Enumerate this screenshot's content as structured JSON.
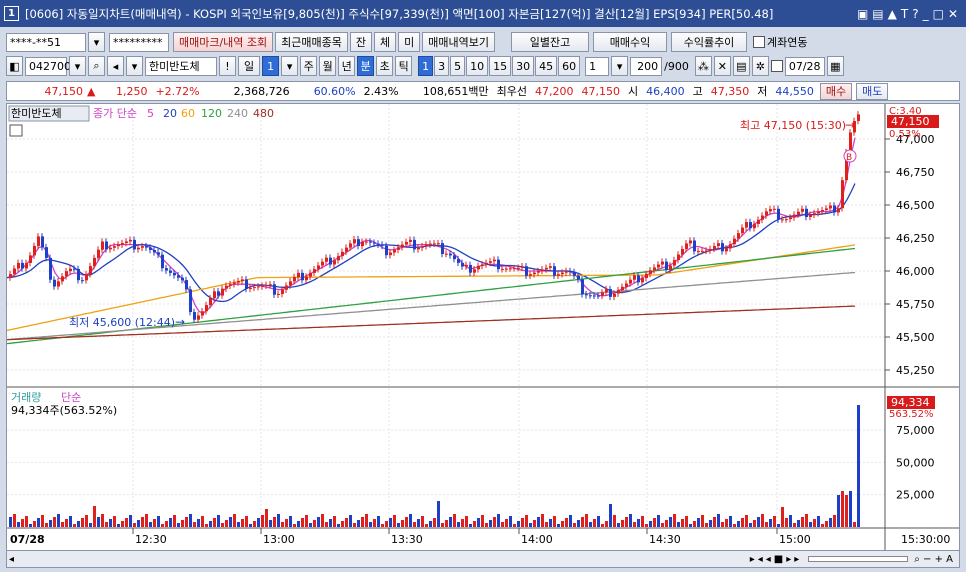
{
  "window": {
    "icon_text": "1",
    "title": "[0606] 자동일지차트(매매내역) - KOSPI 외국인보유[9,805(천)] 주식수[97,339(천)] 액면[100] 자본금[127(억)] 결산[12월] EPS[934] PER[50.48]"
  },
  "toolbar1": {
    "account": "****-**51",
    "password": "*********",
    "btn_mark": "매매마크/내역 조회",
    "btn_recent": "최근매매종목",
    "btn_jan": "잔",
    "btn_che": "체",
    "btn_mi": "미",
    "btn_view": "매매내역보기",
    "btn_daily": "일별잔고",
    "btn_profit": "매매수익",
    "btn_rate": "수익률추이",
    "chk_account": "계좌연동"
  },
  "toolbar2": {
    "code": "042700",
    "name": "한미반도체",
    "period_day": "일",
    "period_num": "1",
    "btn_week": "주",
    "btn_month": "월",
    "btn_year": "년",
    "btn_min": "분",
    "btn_sec": "초",
    "btn_tick": "틱",
    "intervals": [
      "1",
      "3",
      "5",
      "10",
      "15",
      "30",
      "45",
      "60"
    ],
    "interval_sel": "1",
    "count": "200",
    "total": "/900",
    "date": "07/28"
  },
  "info": {
    "price": "47,150",
    "change": "1,250",
    "rate": "+2.72%",
    "volume": "2,368,726",
    "vol_ratio": "60.60%",
    "v2": "2.43%",
    "amount": "108,651백만",
    "best": "최우선",
    "ask": "47,200",
    "bid": "47,150",
    "open_label": "시",
    "open": "46,400",
    "high_label": "고",
    "high": "47,350",
    "low_label": "저",
    "low": "44,550",
    "buy": "매수",
    "sell": "매도"
  },
  "price_panel": {
    "stock_label": "한미반도체",
    "ma_label": "종가 단순",
    "ma5": "5",
    "ma20": "20",
    "ma60": "60",
    "ma120": "120",
    "ma240": "240",
    "ma480": "480",
    "high_annot": "최고 47,150 (15:30)",
    "low_annot": "최저 45,600 (12:44)",
    "right_c": "C:3.40",
    "right_price": "47,150",
    "right_pct": "0.53%",
    "buy_marker": "B",
    "yticks": [
      "47,000",
      "46,750",
      "46,500",
      "46,250",
      "46,000",
      "45,750",
      "45,500",
      "45,250"
    ]
  },
  "volume_panel": {
    "label": "거래량",
    "ma": "단순",
    "value": "94,334주(563.52%)",
    "right_vol": "94,334",
    "right_pct": "563.52%",
    "yticks": [
      "75,000",
      "50,000",
      "25,000"
    ]
  },
  "xaxis": {
    "date": "07/28",
    "ticks": [
      "12:30",
      "13:00",
      "13:30",
      "14:00",
      "14:30",
      "15:00"
    ],
    "end": "15:30:00"
  },
  "colors": {
    "up": "#e0201c",
    "down": "#1e3fc8",
    "ma5": "#d040c8",
    "ma20": "#2040c0",
    "ma60": "#f0a010",
    "ma120": "#30a040",
    "ma240": "#909090",
    "ma480": "#a03020"
  }
}
